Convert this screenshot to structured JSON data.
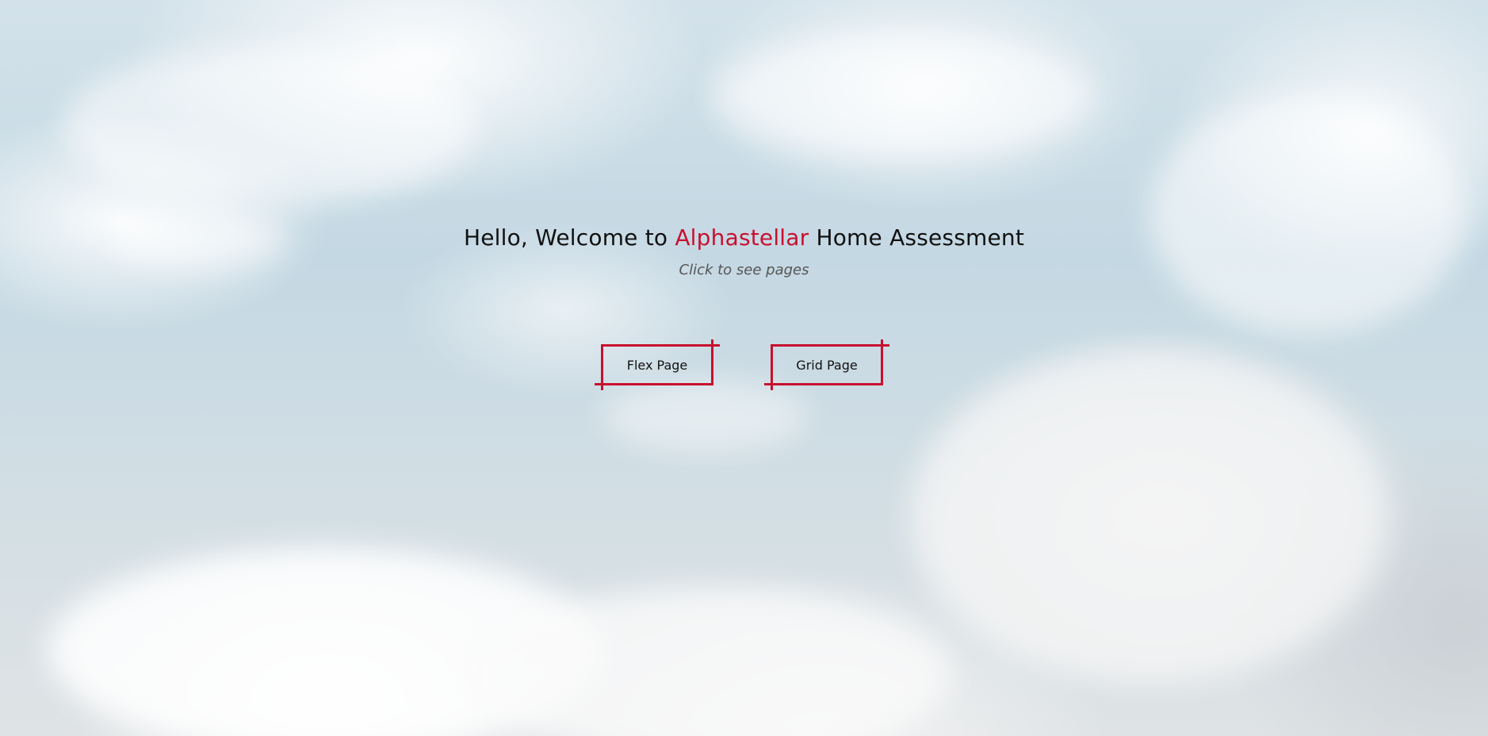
{
  "hero": {
    "headline_prefix": "Hello, Welcome to ",
    "headline_brand": "Alphastellar",
    "headline_suffix": " Home Assessment",
    "subtitle": "Click to see pages"
  },
  "buttons": {
    "flex_label": "Flex Page",
    "grid_label": "Grid Page"
  },
  "colors": {
    "accent": "#c8102e",
    "text": "#111111",
    "subtitle": "#555555"
  }
}
